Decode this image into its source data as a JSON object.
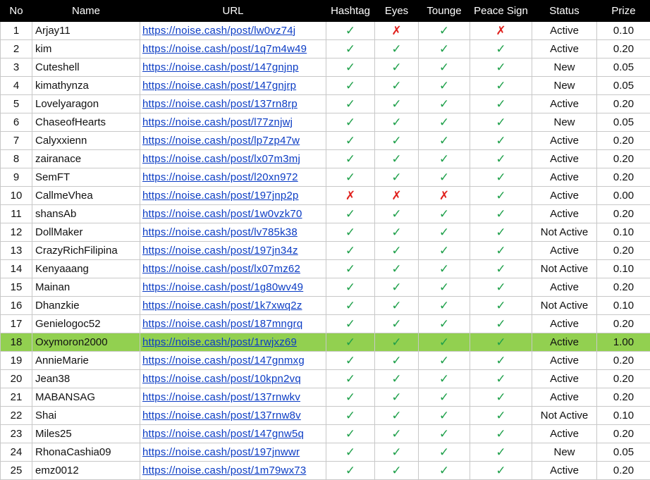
{
  "headers": {
    "no": "No",
    "name": "Name",
    "url": "URL",
    "hashtag": "Hashtag",
    "eyes": "Eyes",
    "tounge": "Tounge",
    "peace_sign": "Peace Sign",
    "status": "Status",
    "prize": "Prize"
  },
  "symbols": {
    "yes": "✓",
    "no": "✗"
  },
  "colors": {
    "check": "#1ea04a",
    "cross": "#e0201c",
    "highlight_row": "#92d050",
    "header_bg": "#000000",
    "link": "#0b3cc4"
  },
  "highlighted_row_no": "18",
  "rows": [
    {
      "no": "1",
      "name": "Arjay11",
      "url": "https://noise.cash/post/lw0vz74j",
      "hashtag": "yes",
      "eyes": "no",
      "tounge": "yes",
      "peace_sign": "no",
      "status": "Active",
      "prize": "0.10"
    },
    {
      "no": "2",
      "name": "kim",
      "url": "https://noise.cash/post/1q7m4w49",
      "hashtag": "yes",
      "eyes": "yes",
      "tounge": "yes",
      "peace_sign": "yes",
      "status": "Active",
      "prize": "0.20"
    },
    {
      "no": "3",
      "name": "Cuteshell",
      "url": "https://noise.cash/post/147gnjnp",
      "hashtag": "yes",
      "eyes": "yes",
      "tounge": "yes",
      "peace_sign": "yes",
      "status": "New",
      "prize": "0.05"
    },
    {
      "no": "4",
      "name": "kimathynza",
      "url": "https://noise.cash/post/147gnjrp",
      "hashtag": "yes",
      "eyes": "yes",
      "tounge": "yes",
      "peace_sign": "yes",
      "status": "New",
      "prize": "0.05"
    },
    {
      "no": "5",
      "name": "Lovelyaragon",
      "url": "https://noise.cash/post/137rn8rp",
      "hashtag": "yes",
      "eyes": "yes",
      "tounge": "yes",
      "peace_sign": "yes",
      "status": "Active",
      "prize": "0.20"
    },
    {
      "no": "6",
      "name": "ChaseofHearts",
      "url": "https://noise.cash/post/l77znjwj",
      "hashtag": "yes",
      "eyes": "yes",
      "tounge": "yes",
      "peace_sign": "yes",
      "status": "New",
      "prize": "0.05"
    },
    {
      "no": "7",
      "name": "Calyxxienn",
      "url": "https://noise.cash/post/lp7zp47w",
      "hashtag": "yes",
      "eyes": "yes",
      "tounge": "yes",
      "peace_sign": "yes",
      "status": "Active",
      "prize": "0.20"
    },
    {
      "no": "8",
      "name": "zairanace",
      "url": "https://noise.cash/post/lx07m3mj",
      "hashtag": "yes",
      "eyes": "yes",
      "tounge": "yes",
      "peace_sign": "yes",
      "status": "Active",
      "prize": "0.20"
    },
    {
      "no": "9",
      "name": "SemFT",
      "url": "https://noise.cash/post/l20xn972",
      "hashtag": "yes",
      "eyes": "yes",
      "tounge": "yes",
      "peace_sign": "yes",
      "status": "Active",
      "prize": "0.20"
    },
    {
      "no": "10",
      "name": "CallmeVhea",
      "url": "https://noise.cash/post/197jnp2p",
      "hashtag": "no",
      "eyes": "no",
      "tounge": "no",
      "peace_sign": "yes",
      "status": "Active",
      "prize": "0.00"
    },
    {
      "no": "11",
      "name": "shansAb",
      "url": "https://noise.cash/post/1w0vzk70",
      "hashtag": "yes",
      "eyes": "yes",
      "tounge": "yes",
      "peace_sign": "yes",
      "status": "Active",
      "prize": "0.20"
    },
    {
      "no": "12",
      "name": "DollMaker",
      "url": "https://noise.cash/post/lv785k38",
      "hashtag": "yes",
      "eyes": "yes",
      "tounge": "yes",
      "peace_sign": "yes",
      "status": "Not Active",
      "prize": "0.10"
    },
    {
      "no": "13",
      "name": "CrazyRichFilipina",
      "url": "https://noise.cash/post/197jn34z",
      "hashtag": "yes",
      "eyes": "yes",
      "tounge": "yes",
      "peace_sign": "yes",
      "status": "Active",
      "prize": "0.20"
    },
    {
      "no": "14",
      "name": "Kenyaaang",
      "url": "https://noise.cash/post/lx07mz62",
      "hashtag": "yes",
      "eyes": "yes",
      "tounge": "yes",
      "peace_sign": "yes",
      "status": "Not Active",
      "prize": "0.10"
    },
    {
      "no": "15",
      "name": "Mainan",
      "url": "https://noise.cash/post/1g80wv49",
      "hashtag": "yes",
      "eyes": "yes",
      "tounge": "yes",
      "peace_sign": "yes",
      "status": "Active",
      "prize": "0.20"
    },
    {
      "no": "16",
      "name": "Dhanzkie",
      "url": "https://noise.cash/post/1k7xwq2z",
      "hashtag": "yes",
      "eyes": "yes",
      "tounge": "yes",
      "peace_sign": "yes",
      "status": "Not Active",
      "prize": "0.10"
    },
    {
      "no": "17",
      "name": "Genielogoc52",
      "url": "https://noise.cash/post/187mngrq",
      "hashtag": "yes",
      "eyes": "yes",
      "tounge": "yes",
      "peace_sign": "yes",
      "status": "Active",
      "prize": "0.20"
    },
    {
      "no": "18",
      "name": "Oxymoron2000",
      "url": "https://noise.cash/post/1rwjxz69",
      "hashtag": "yes",
      "eyes": "yes",
      "tounge": "yes",
      "peace_sign": "yes",
      "status": "Active",
      "prize": "1.00"
    },
    {
      "no": "19",
      "name": "AnnieMarie",
      "url": "https://noise.cash/post/147gnmxg",
      "hashtag": "yes",
      "eyes": "yes",
      "tounge": "yes",
      "peace_sign": "yes",
      "status": "Active",
      "prize": "0.20"
    },
    {
      "no": "20",
      "name": "Jean38",
      "url": "https://noise.cash/post/10kpn2vq",
      "hashtag": "yes",
      "eyes": "yes",
      "tounge": "yes",
      "peace_sign": "yes",
      "status": "Active",
      "prize": "0.20"
    },
    {
      "no": "21",
      "name": "MABANSAG",
      "url": "https://noise.cash/post/137rnwkv",
      "hashtag": "yes",
      "eyes": "yes",
      "tounge": "yes",
      "peace_sign": "yes",
      "status": "Active",
      "prize": "0.20"
    },
    {
      "no": "22",
      "name": "Shai",
      "url": "https://noise.cash/post/137rnw8v",
      "hashtag": "yes",
      "eyes": "yes",
      "tounge": "yes",
      "peace_sign": "yes",
      "status": "Not Active",
      "prize": "0.10"
    },
    {
      "no": "23",
      "name": "Miles25",
      "url": "https://noise.cash/post/147gnw5q",
      "hashtag": "yes",
      "eyes": "yes",
      "tounge": "yes",
      "peace_sign": "yes",
      "status": "Active",
      "prize": "0.20"
    },
    {
      "no": "24",
      "name": "RhonaCashia09",
      "url": "https://noise.cash/post/197jnwwr",
      "hashtag": "yes",
      "eyes": "yes",
      "tounge": "yes",
      "peace_sign": "yes",
      "status": "New",
      "prize": "0.05"
    },
    {
      "no": "25",
      "name": "emz0012",
      "url": "https://noise.cash/post/1m79wx73",
      "hashtag": "yes",
      "eyes": "yes",
      "tounge": "yes",
      "peace_sign": "yes",
      "status": "Active",
      "prize": "0.20"
    }
  ]
}
